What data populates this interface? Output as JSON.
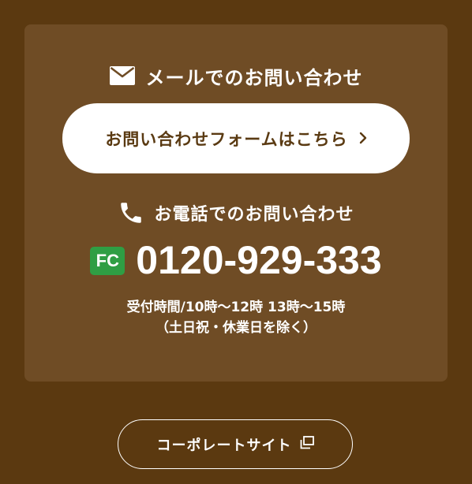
{
  "mail": {
    "heading": "メールでのお問い合わせ",
    "icon": "mail-icon",
    "button_label": "お問い合わせフォームはこちら",
    "button_icon": "chevron-right-icon"
  },
  "phone": {
    "heading": "お電話でのお問い合わせ",
    "icon": "phone-icon",
    "badge": "FC",
    "number": "0120-929-333",
    "hours": "受付時間/10時〜12時 13時〜15時",
    "closed_days": "（土日祝・休業日を除く）"
  },
  "corporate": {
    "button_label": "コーポレートサイト",
    "button_icon": "external-window-icon"
  },
  "colors": {
    "background": "#5b3910",
    "card": "#6f4c25",
    "badge": "#2f9e44",
    "button_text": "#5a3a12"
  }
}
